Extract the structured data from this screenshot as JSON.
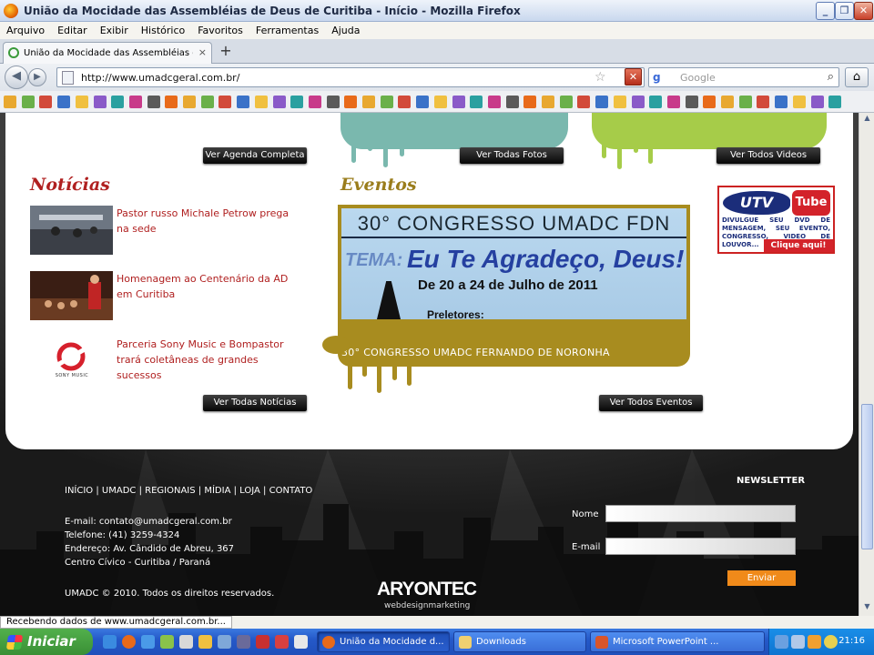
{
  "window": {
    "title": "União da Mocidade das Assembléias de Deus de Curitiba - Início - Mozilla Firefox"
  },
  "menu": [
    "Arquivo",
    "Editar",
    "Exibir",
    "Histórico",
    "Favoritos",
    "Ferramentas",
    "Ajuda"
  ],
  "tab": {
    "label": "União da Mocidade das Assembléias de Deus...",
    "new_tab": "+"
  },
  "nav": {
    "url": "http://www.umadcgeral.com.br/",
    "search_placeholder": "Google",
    "search_engine_glyph": "g"
  },
  "page": {
    "top_buttons": {
      "agenda": "Ver Agenda Completa",
      "fotos": "Ver Todas Fotos",
      "videos": "Ver Todos Videos"
    },
    "noticias": {
      "heading": "Notícias",
      "items": [
        {
          "title": "Pastor russo Michale Petrow prega na sede"
        },
        {
          "title": "Homenagem ao Centenário da AD em Curitiba"
        },
        {
          "title": "Parceria Sony Music e Bompastor trará coletâneas de grandes sucessos"
        }
      ],
      "button": "Ver Todas Notícias",
      "sony_caption": "SONY MUSIC"
    },
    "eventos": {
      "heading": "Eventos",
      "banner": {
        "line1": "30° CONGRESSO UMADC FDN",
        "tema": "TEMA:",
        "main": "Eu Te Agradeço, Deus!",
        "date": "De 20 a 24 de Julho de 2011",
        "preletores": "Preletores:"
      },
      "caption": "30° CONGRESSO UMADC FERNANDO DE NORONHA",
      "button": "Ver Todos Eventos"
    },
    "youtube": {
      "logo_a": "UTV",
      "logo_b": "Tube",
      "text": "DIVULGUE SEU DVD DE MENSAGEM, SEU EVENTO, CONGRESSO, VIDEO DE LOUVOR...",
      "cta": "Clique aqui!"
    },
    "footer": {
      "links": [
        "INÍCIO",
        "UMADC",
        "REGIONAIS",
        "MÍDIA",
        "LOJA",
        "CONTATO"
      ],
      "separator": " | ",
      "email": "E-mail: contato@umadcgeral.com.br",
      "phone": "Telefone: (41) 3259-4324",
      "address": "Endereço: Av. Cândido de Abreu, 367",
      "city": "Centro Cívico - Curitiba / Paraná",
      "copyright": "UMADC © 2010. Todos os direitos reservados.",
      "brand": "ARYONTEC",
      "brand_sub": "webdesignmarketing",
      "newsletter": {
        "title": "NEWSLETTER",
        "name_label": "Nome",
        "email_label": "E-mail",
        "submit": "Enviar"
      }
    }
  },
  "status": "Recebendo dados de www.umadcgeral.com.br...",
  "taskbar": {
    "start": "Iniciar",
    "tasks": [
      "União da Mocidade d...",
      "Downloads",
      "Microsoft PowerPoint ..."
    ],
    "clock": "21:16"
  },
  "colors": {
    "accent_red": "#b02020",
    "heading_gold": "#9a7d1c",
    "event_gold": "#a88c1f",
    "teal_drip": "#7ab8ae",
    "green_drip": "#a6cc49",
    "orange_button": "#f08a1a"
  }
}
